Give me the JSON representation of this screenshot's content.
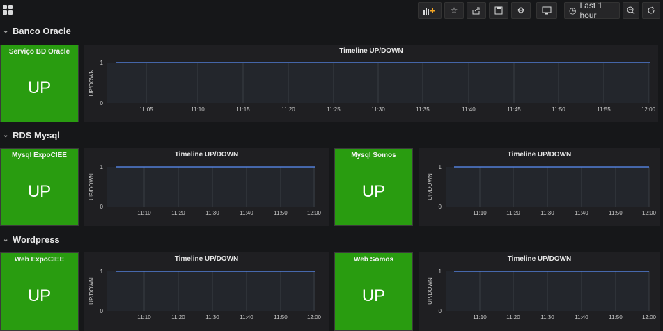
{
  "toolbar": {
    "time_range_label": "Last 1 hour"
  },
  "rows": [
    {
      "title": "Banco Oracle",
      "panels": [
        {
          "stat_title": "Serviço BD Oracle",
          "stat_value": "UP",
          "graph_title": "Timeline UP/DOWN",
          "y_label": "UP/DOWN",
          "y_ticks": [
            "0",
            "1"
          ],
          "x_ticks": [
            "11:05",
            "11:10",
            "11:15",
            "11:20",
            "11:25",
            "11:30",
            "11:35",
            "11:40",
            "11:45",
            "11:50",
            "11:55",
            "12:00"
          ]
        }
      ]
    },
    {
      "title": "RDS Mysql",
      "panels": [
        {
          "stat_title": "Mysql ExpoCIEE",
          "stat_value": "UP",
          "graph_title": "Timeline UP/DOWN",
          "y_label": "UP/DOWN",
          "y_ticks": [
            "0",
            "1"
          ],
          "x_ticks": [
            "11:10",
            "11:20",
            "11:30",
            "11:40",
            "11:50",
            "12:00"
          ]
        },
        {
          "stat_title": "Mysql Somos",
          "stat_value": "UP",
          "graph_title": "Timeline UP/DOWN",
          "y_label": "UP/DOWN",
          "y_ticks": [
            "0",
            "1"
          ],
          "x_ticks": [
            "11:10",
            "11:20",
            "11:30",
            "11:40",
            "11:50",
            "12:00"
          ]
        }
      ]
    },
    {
      "title": "Wordpress",
      "panels": [
        {
          "stat_title": "Web ExpoCIEE",
          "stat_value": "UP",
          "graph_title": "Timeline UP/DOWN",
          "y_label": "UP/DOWN",
          "y_ticks": [
            "0",
            "1"
          ],
          "x_ticks": [
            "11:10",
            "11:20",
            "11:30",
            "11:40",
            "11:50",
            "12:00"
          ]
        },
        {
          "stat_title": "Web Somos",
          "stat_value": "UP",
          "graph_title": "Timeline UP/DOWN",
          "y_label": "UP/DOWN",
          "y_ticks": [
            "0",
            "1"
          ],
          "x_ticks": [
            "11:10",
            "11:20",
            "11:30",
            "11:40",
            "11:50",
            "12:00"
          ]
        }
      ]
    }
  ],
  "colors": {
    "up": "#299c10",
    "series": "#5b8ff9",
    "background": "#161719",
    "panel": "#1f1f22"
  },
  "series_value": 1
}
